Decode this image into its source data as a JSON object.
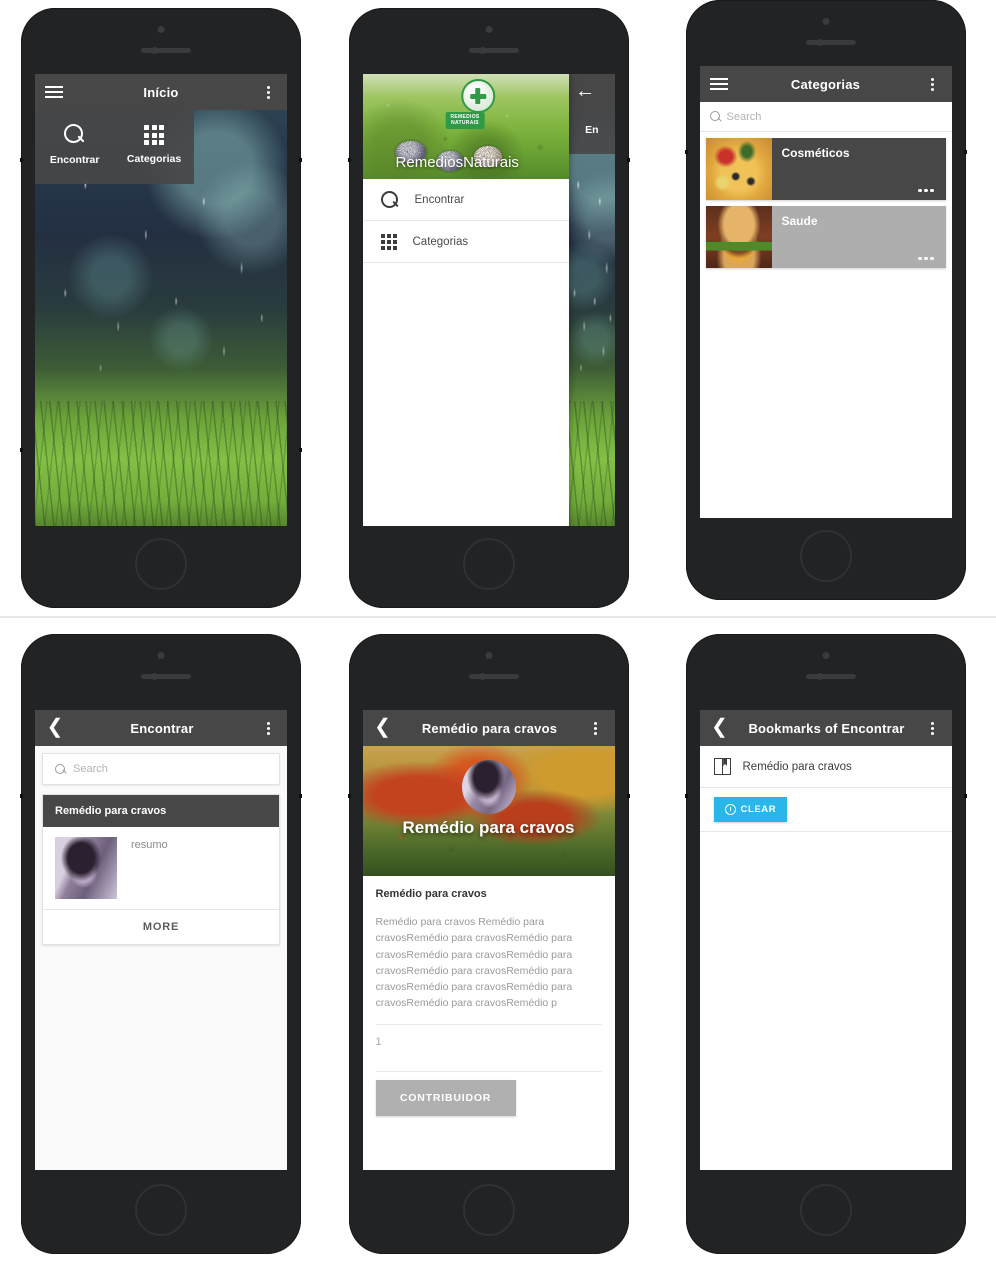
{
  "app": {
    "name": "RemediosNaturais",
    "accent_cyan": "#29b6e8",
    "appbar_color": "#474747",
    "card_grey": "#aeaeae"
  },
  "screens": {
    "home": {
      "title": "Início",
      "menu_icon": "hamburger-icon",
      "overflow_icon": "kebab-icon",
      "quick_actions": [
        {
          "label": "Encontrar",
          "icon": "search-icon"
        },
        {
          "label": "Categorias",
          "icon": "grid-icon"
        }
      ]
    },
    "drawer": {
      "title": "RemediosNaturais",
      "logo_banner": "REMEDIOS\nNATURAIS",
      "logo_banner_line1": "REMEDIOS",
      "logo_banner_line2": "NATURAIS",
      "back_icon": "back-arrow-icon",
      "peek_label": "En",
      "items": [
        {
          "label": "Encontrar",
          "icon": "search-icon"
        },
        {
          "label": "Categorias",
          "icon": "grid-icon"
        }
      ]
    },
    "categories": {
      "title": "Categorias",
      "menu_icon": "hamburger-icon",
      "overflow_icon": "kebab-icon",
      "search": {
        "placeholder": "Search",
        "value": ""
      },
      "items": [
        {
          "name": "Cosméticos",
          "thumb": "pizza-image",
          "style": "dark",
          "more_icon": "ellipsis-icon"
        },
        {
          "name": "Saude",
          "thumb": "burger-image",
          "style": "grey",
          "more_icon": "ellipsis-icon"
        }
      ]
    },
    "find": {
      "title": "Encontrar",
      "back_icon": "back-chevron-icon",
      "overflow_icon": "kebab-icon",
      "search": {
        "placeholder": "Search",
        "value": ""
      },
      "card": {
        "heading": "Remédio para cravos",
        "summary": "resumo",
        "thumb": "person-photo",
        "more_label": "MORE"
      }
    },
    "detail": {
      "title": "Remédio para cravos",
      "back_icon": "back-chevron-icon",
      "overflow_icon": "kebab-icon",
      "hero_title": "Remédio para cravos",
      "avatar": "person-avatar",
      "section_title": "Remédio para cravos",
      "body": "Remédio para cravos\nRemédio para cravosRemédio para cravosRemédio para cravosRemédio para cravosRemédio para cravosRemédio para cravosRemédio para cravosRemédio para cravosRemédio para cravosRemédio para cravosRemédio p",
      "count": "1",
      "button_label": "CONTRIBUIDOR"
    },
    "bookmarks": {
      "title": "Bookmarks of Encontrar",
      "back_icon": "back-chevron-icon",
      "overflow_icon": "kebab-icon",
      "items": [
        {
          "label": "Remédio para cravos",
          "icon": "book-bookmark-icon"
        }
      ],
      "clear_label": "CLEAR",
      "clear_icon": "clear-circle-icon"
    }
  }
}
